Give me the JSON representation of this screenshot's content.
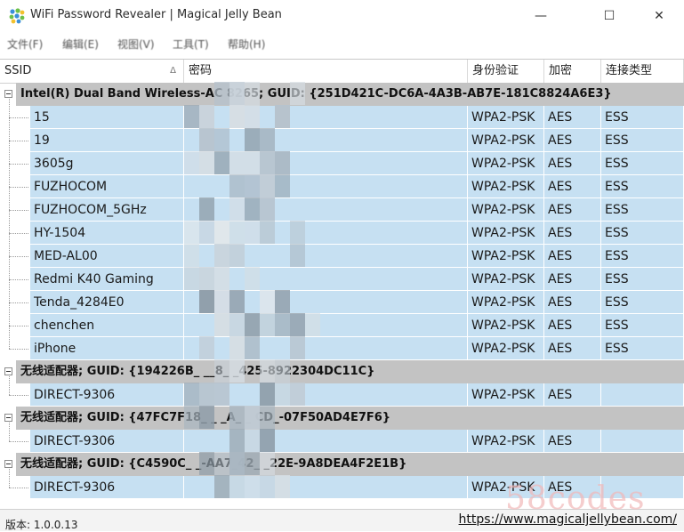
{
  "window": {
    "title": "WiFi Password Revealer | Magical Jelly Bean",
    "minimize_glyph": "—",
    "maximize_glyph": "☐",
    "close_glyph": "✕"
  },
  "menu": {
    "items": [
      "文件(F)",
      "编辑(E)",
      "视图(V)",
      "工具(T)",
      "帮助(H)"
    ]
  },
  "columns": {
    "ssid": "SSID",
    "password": "密码",
    "auth": "身份验证",
    "cipher": "加密",
    "conn_type": "连接类型",
    "sort_glyph": "Δ"
  },
  "groups": [
    {
      "label": "Intel(R) Dual Band Wireless-AC 8265; GUID: {251D421C-DC6A-4A3B-AB7E-181C8824A6E3}",
      "rows": [
        {
          "ssid": "15",
          "auth": "WPA2-PSK",
          "cipher": "AES",
          "type": "ESS"
        },
        {
          "ssid": "19",
          "auth": "WPA2-PSK",
          "cipher": "AES",
          "type": "ESS"
        },
        {
          "ssid": "3605g",
          "auth": "WPA2-PSK",
          "cipher": "AES",
          "type": "ESS"
        },
        {
          "ssid": "FUZHOCOM",
          "auth": "WPA2-PSK",
          "cipher": "AES",
          "type": "ESS"
        },
        {
          "ssid": "FUZHOCOM_5GHz",
          "auth": "WPA2-PSK",
          "cipher": "AES",
          "type": "ESS"
        },
        {
          "ssid": "HY-1504",
          "auth": "WPA2-PSK",
          "cipher": "AES",
          "type": "ESS"
        },
        {
          "ssid": "MED-AL00",
          "auth": "WPA2-PSK",
          "cipher": "AES",
          "type": "ESS"
        },
        {
          "ssid": "Redmi K40 Gaming",
          "auth": "WPA2-PSK",
          "cipher": "AES",
          "type": "ESS"
        },
        {
          "ssid": "Tenda_4284E0",
          "auth": "WPA2-PSK",
          "cipher": "AES",
          "type": "ESS"
        },
        {
          "ssid": "chenchen",
          "auth": "WPA2-PSK",
          "cipher": "AES",
          "type": "ESS"
        },
        {
          "ssid": "iPhone",
          "auth": "WPA2-PSK",
          "cipher": "AES",
          "type": "ESS"
        }
      ]
    },
    {
      "label": "无线适配器; GUID: {194226B_ __8_ _425-8922304DC11C}",
      "rows": [
        {
          "ssid": "DIRECT-9306",
          "auth": "WPA2-PSK",
          "cipher": "AES",
          "type": ""
        }
      ]
    },
    {
      "label": "无线适配器; GUID: {47FC7F18_ _ _A_ _ CD_-07F50AD4E7F6}",
      "rows": [
        {
          "ssid": "DIRECT-9306",
          "auth": "WPA2-PSK",
          "cipher": "AES",
          "type": ""
        }
      ]
    },
    {
      "label": "无线适配器; GUID: {C4590C_ _-AA7_42_ _22E-9A8DEA4F2E1B}",
      "rows": [
        {
          "ssid": "DIRECT-9306",
          "auth": "WPA2-PSK",
          "cipher": "AES",
          "type": ""
        }
      ]
    }
  ],
  "status": {
    "version": "版本: 1.0.0.13",
    "link": "https://www.magicaljellybean.com/"
  },
  "watermark": "58codes",
  "colors": {
    "group_bg": "#c3c3c3",
    "row_bg": "#c6e0f2"
  }
}
